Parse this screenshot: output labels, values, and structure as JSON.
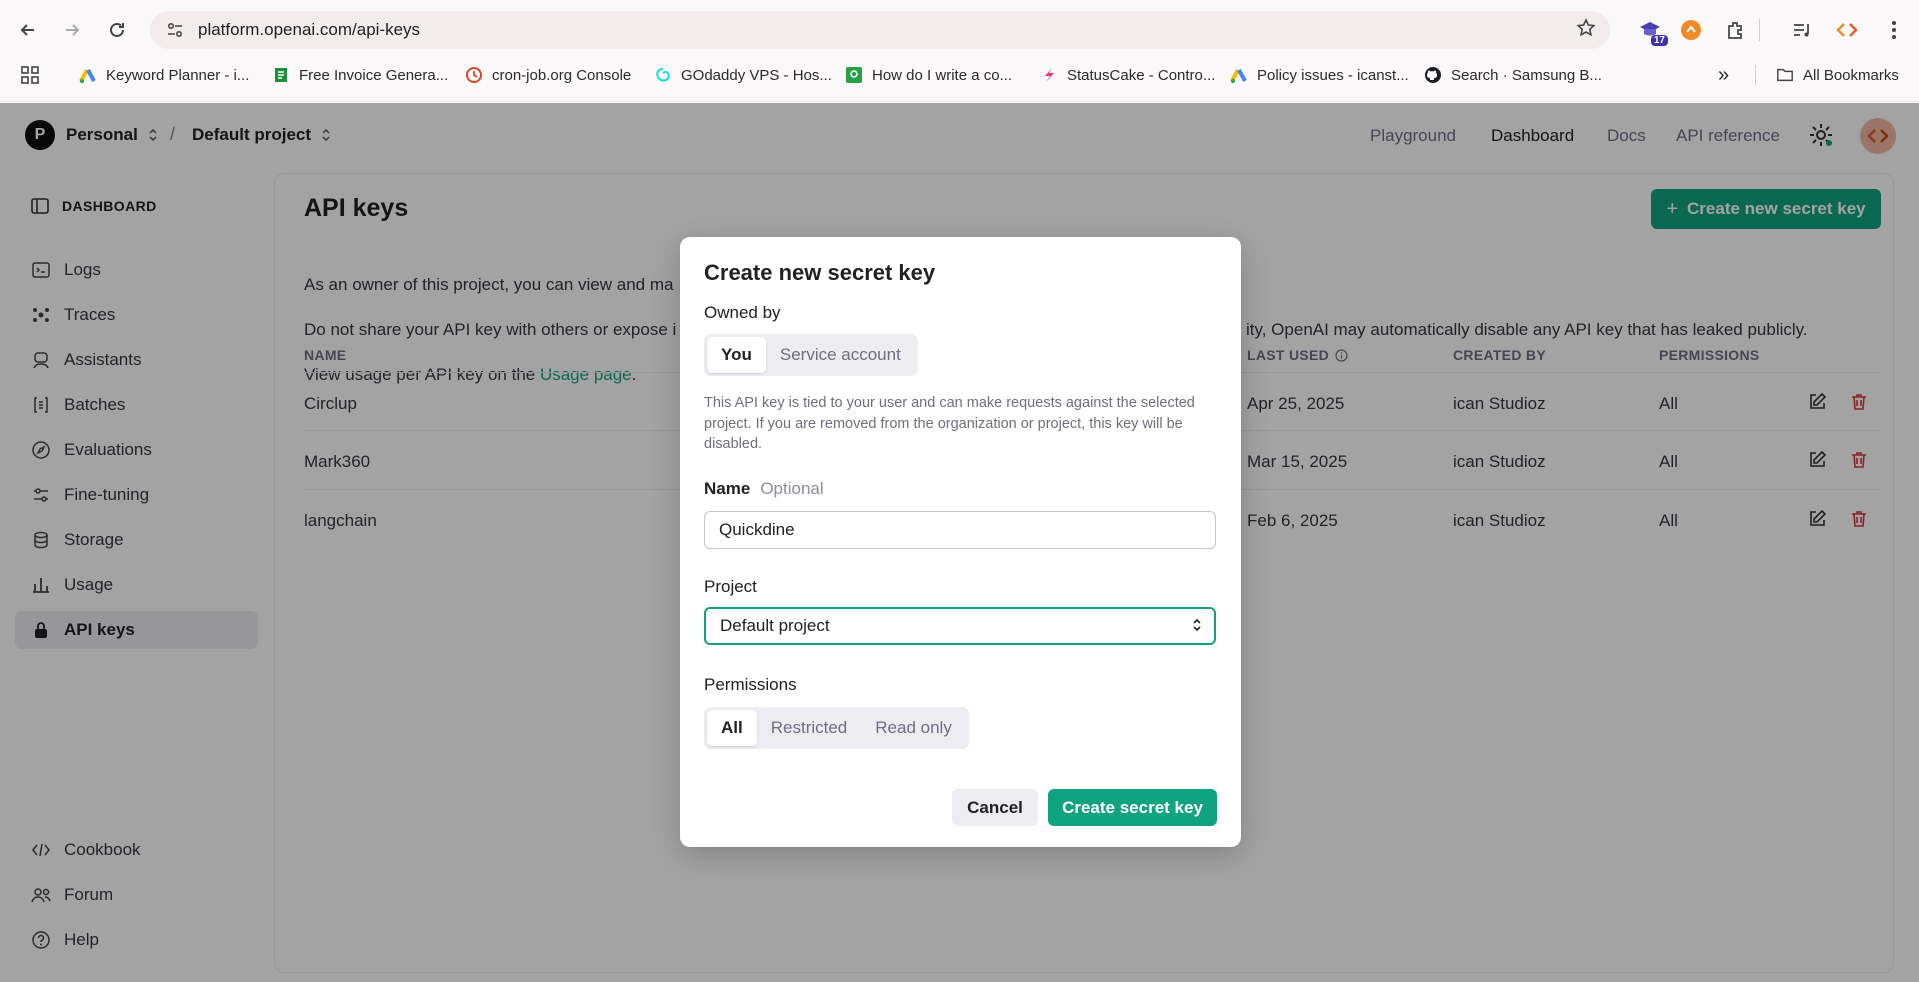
{
  "browser": {
    "url": "platform.openai.com/api-keys",
    "ext_badge": "17",
    "bookmarks": [
      "Keyword Planner - i...",
      "Free Invoice Genera...",
      "cron-job.org Console",
      "GOdaddy VPS - Hos...",
      "How do I write a co...",
      "StatusCake - Contro...",
      "Policy issues - icanst...",
      "Search · Samsung B..."
    ],
    "more_bookmarks": "»",
    "all_bookmarks": "All Bookmarks"
  },
  "header": {
    "workspace_initial": "P",
    "workspace": "Personal",
    "separator": "/",
    "project": "Default project",
    "links": [
      "Playground",
      "Dashboard",
      "Docs",
      "API reference"
    ],
    "active_link": "Dashboard"
  },
  "sidebar": {
    "heading": "DASHBOARD",
    "items": [
      {
        "label": "Logs",
        "icon": "terminal-icon"
      },
      {
        "label": "Traces",
        "icon": "traces-icon"
      },
      {
        "label": "Assistants",
        "icon": "assistant-icon"
      },
      {
        "label": "Batches",
        "icon": "batch-icon"
      },
      {
        "label": "Evaluations",
        "icon": "compass-icon"
      },
      {
        "label": "Fine-tuning",
        "icon": "sliders-icon"
      },
      {
        "label": "Storage",
        "icon": "database-icon"
      },
      {
        "label": "Usage",
        "icon": "bar-chart-icon"
      },
      {
        "label": "API keys",
        "icon": "lock-icon",
        "active": true
      }
    ],
    "bottom": [
      {
        "label": "Cookbook",
        "icon": "code-icon"
      },
      {
        "label": "Forum",
        "icon": "users-icon"
      },
      {
        "label": "Help",
        "icon": "help-icon"
      }
    ]
  },
  "main": {
    "title": "API keys",
    "create_button": "Create new secret key",
    "para1": "As an owner of this project, you can view and ma",
    "para2_start": "Do not share your API key with others or expose i",
    "para2_end": "ity, OpenAI may automatically disable any API key that has leaked publicly.",
    "para3_prefix": "View usage per API key on the ",
    "para3_link": "Usage page",
    "para3_suffix": ".",
    "columns": {
      "name": "NAME",
      "last_used": "LAST USED",
      "created_by": "CREATED BY",
      "permissions": "PERMISSIONS"
    },
    "rows": [
      {
        "name": "Circlup",
        "last_used": "Apr 25, 2025",
        "created_by": "ican Studioz",
        "permissions": "All"
      },
      {
        "name": "Mark360",
        "last_used": "Mar 15, 2025",
        "created_by": "ican Studioz",
        "permissions": "All"
      },
      {
        "name": "langchain",
        "last_used": "Feb 6, 2025",
        "created_by": "ican Studioz",
        "permissions": "All"
      }
    ]
  },
  "modal": {
    "title": "Create new secret key",
    "owned_by_label": "Owned by",
    "owned_by_options": [
      "You",
      "Service account"
    ],
    "owned_by_selected": "You",
    "help_text": "This API key is tied to your user and can make requests against the selected project. If you are removed from the organization or project, this key will be disabled.",
    "name_label": "Name",
    "name_optional": "Optional",
    "name_value": "Quickdine",
    "project_label": "Project",
    "project_value": "Default project",
    "permissions_label": "Permissions",
    "permission_options": [
      "All",
      "Restricted",
      "Read only"
    ],
    "permission_selected": "All",
    "cancel": "Cancel",
    "submit": "Create secret key"
  },
  "colors": {
    "accent": "#10a37f",
    "danger": "#d9363e",
    "overlay": "rgba(0,0,0,0.36)"
  }
}
